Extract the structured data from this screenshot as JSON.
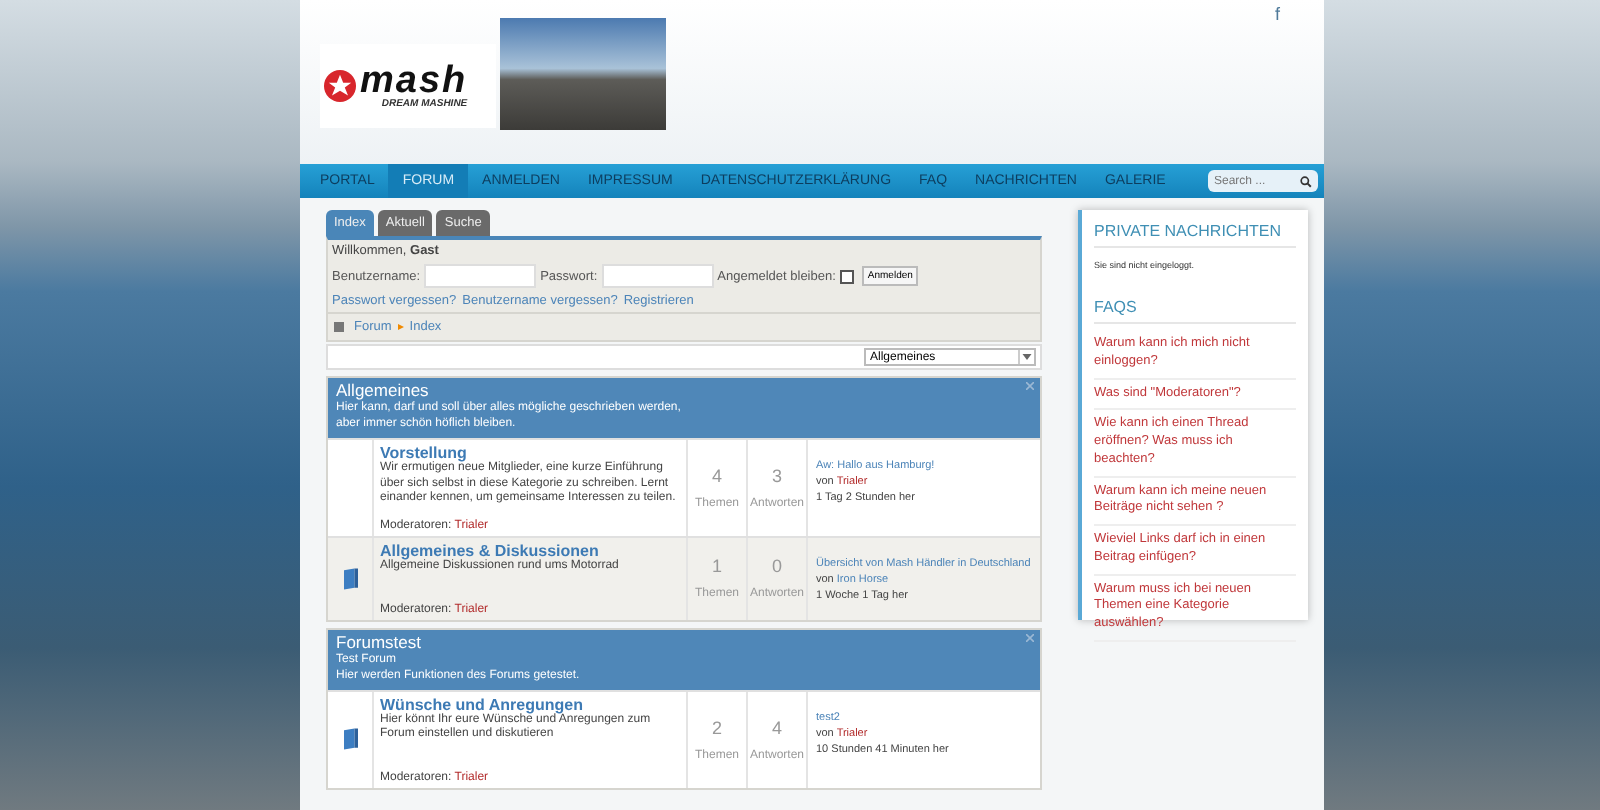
{
  "header": {
    "social_icon": "f",
    "logo_text": "mash",
    "logo_tagline": "DREAM MASHINE"
  },
  "nav": {
    "items": [
      {
        "label": "PORTAL",
        "selected": false
      },
      {
        "label": "FORUM",
        "selected": true
      },
      {
        "label": "ANMELDEN",
        "selected": false
      },
      {
        "label": "IMPRESSUM",
        "selected": false
      },
      {
        "label": "DATENSCHUTZERKLÄRUNG",
        "selected": false
      },
      {
        "label": "FAQ",
        "selected": false
      },
      {
        "label": "NACHRICHTEN",
        "selected": false
      },
      {
        "label": "GALERIE",
        "selected": false
      }
    ],
    "search_placeholder": "Search ..."
  },
  "tabs": [
    {
      "label": "Index",
      "selected": true
    },
    {
      "label": "Aktuell",
      "selected": false
    },
    {
      "label": "Suche",
      "selected": false
    }
  ],
  "login": {
    "welcome": "Willkommen, **Gast**",
    "username_label": "Benutzername:",
    "password_label": "Passwort:",
    "remember_label": "Angemeldet bleiben:",
    "remember_checked": false,
    "button": "Anmelden",
    "links": [
      "Passwort vergessen?",
      "Benutzername vergessen?",
      "Registrieren"
    ]
  },
  "breadcrumb": [
    "Forum",
    "Index"
  ],
  "jump_select": "Allgemeines",
  "categories": [
    {
      "title": "Allgemeines",
      "description": [
        "Hier kann, darf und soll über alles mögliche geschrieben werden,",
        "aber immer schön höflich bleiben."
      ],
      "forums": [
        {
          "icon": false,
          "title": "Vorstellung",
          "description": "Wir ermutigen neue Mitglieder, eine kurze Einführung über sich selbst in diese Kategorie zu schreiben. Lernt einander kennen, um gemeinsame Interessen zu teilen.",
          "moderators_label": "Moderatoren:",
          "moderator": "Trialer",
          "topics": "4",
          "topics_label": "Themen",
          "replies": "3",
          "replies_label": "Antworten",
          "last_post": {
            "title": "Aw: Hallo aus Hamburg!",
            "by": "von",
            "author": "Trialer",
            "author_highlighted": true,
            "time": "1 Tag 2 Stunden her"
          }
        },
        {
          "icon": true,
          "title": "Allgemeines & Diskussionen",
          "description": "Allgemeine Diskussionen rund ums Motorrad",
          "moderators_label": "Moderatoren:",
          "moderator": "Trialer",
          "topics": "1",
          "topics_label": "Themen",
          "replies": "0",
          "replies_label": "Antworten",
          "last_post": {
            "title": "Übersicht von Mash Händler in Deutschland",
            "by": "von",
            "author": "Iron Horse",
            "author_highlighted": false,
            "time": "1 Woche 1 Tag her"
          }
        }
      ]
    },
    {
      "title": "Forumstest",
      "description": [
        "Test Forum",
        "Hier werden Funktionen des Forums getestet."
      ],
      "forums": [
        {
          "icon": true,
          "title": "Wünsche und Anregungen",
          "description": "Hier könnt Ihr eure Wünsche und Anregungen zum Forum einstellen und diskutieren",
          "moderators_label": "Moderatoren:",
          "moderator": "Trialer",
          "topics": "2",
          "topics_label": "Themen",
          "replies": "4",
          "replies_label": "Antworten",
          "last_post": {
            "title": "test2",
            "by": "von",
            "author": "Trialer",
            "author_highlighted": true,
            "time": "10 Stunden 41 Minuten her"
          }
        }
      ]
    }
  ],
  "sidebar": {
    "private_title": "PRIVATE NACHRICHTEN",
    "private_text": "Sie sind nicht eingeloggt.",
    "faq_title": "FAQS",
    "faqs": [
      "Warum kann ich mich nicht einloggen?",
      "Was sind \"Moderatoren\"?",
      "Wie kann ich einen Thread eröffnen? Was muss ich beachten?",
      "Warum kann ich meine neuen Beiträge nicht sehen ?",
      "Wieviel Links darf ich in einen Beitrag einfügen?",
      "Warum muss ich bei neuen Themen eine Kategorie auswählen?"
    ]
  }
}
